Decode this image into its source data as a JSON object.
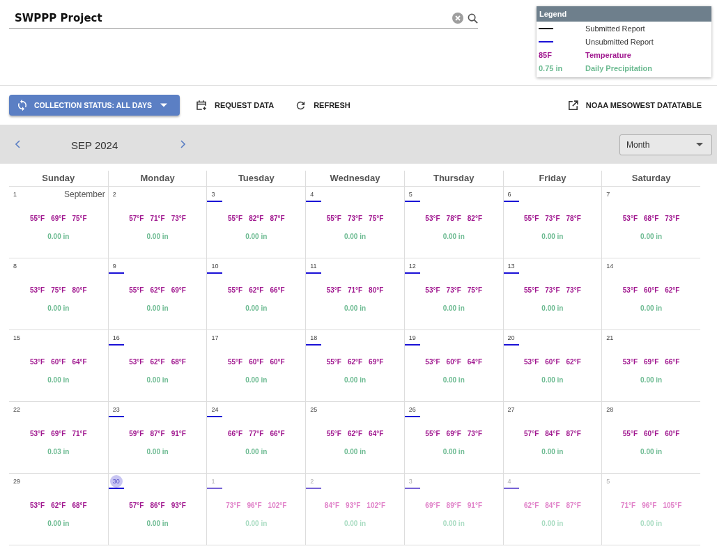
{
  "search": {
    "value": "SWPPP Project"
  },
  "legend": {
    "title": "Legend",
    "items": [
      {
        "kind": "submitted",
        "label": "Submitted Report"
      },
      {
        "kind": "unsubmitted",
        "label": "Unsubmitted Report"
      },
      {
        "kind": "temperature",
        "sample": "85F",
        "label": "Temperature"
      },
      {
        "kind": "precipitation",
        "sample": "0.75 in",
        "label": "Daily Precipitation"
      }
    ]
  },
  "toolbar": {
    "collection_status": "COLLECTION STATUS: ALL DAYS",
    "request": "REQUEST DATA",
    "refresh": "REFRESH",
    "noaa": "NOAA MESOWEST DATATABLE"
  },
  "nav": {
    "period": "SEP 2024",
    "view": "Month"
  },
  "weekdays": [
    "Sunday",
    "Monday",
    "Tuesday",
    "Wednesday",
    "Thursday",
    "Friday",
    "Saturday"
  ],
  "weeks": [
    [
      {
        "day": "1",
        "month_label": "September",
        "temps": [
          "55°F",
          "69°F",
          "75°F"
        ],
        "precip": "0.00 in",
        "unsubmitted": false,
        "outside_month": false,
        "today": false
      },
      {
        "day": "2",
        "temps": [
          "57°F",
          "71°F",
          "73°F"
        ],
        "precip": "0.00 in",
        "unsubmitted": false,
        "outside_month": false,
        "today": false
      },
      {
        "day": "3",
        "temps": [
          "55°F",
          "82°F",
          "87°F"
        ],
        "precip": "0.00 in",
        "unsubmitted": true,
        "outside_month": false,
        "today": false
      },
      {
        "day": "4",
        "temps": [
          "55°F",
          "73°F",
          "75°F"
        ],
        "precip": "0.00 in",
        "unsubmitted": true,
        "outside_month": false,
        "today": false
      },
      {
        "day": "5",
        "temps": [
          "53°F",
          "78°F",
          "82°F"
        ],
        "precip": "0.00 in",
        "unsubmitted": true,
        "outside_month": false,
        "today": false
      },
      {
        "day": "6",
        "temps": [
          "55°F",
          "73°F",
          "78°F"
        ],
        "precip": "0.00 in",
        "unsubmitted": true,
        "outside_month": false,
        "today": false
      },
      {
        "day": "7",
        "temps": [
          "53°F",
          "68°F",
          "73°F"
        ],
        "precip": "0.00 in",
        "unsubmitted": false,
        "outside_month": false,
        "today": false
      }
    ],
    [
      {
        "day": "8",
        "temps": [
          "53°F",
          "75°F",
          "80°F"
        ],
        "precip": "0.00 in",
        "unsubmitted": false,
        "outside_month": false,
        "today": false
      },
      {
        "day": "9",
        "temps": [
          "55°F",
          "62°F",
          "69°F"
        ],
        "precip": "0.00 in",
        "unsubmitted": true,
        "outside_month": false,
        "today": false
      },
      {
        "day": "10",
        "temps": [
          "55°F",
          "62°F",
          "66°F"
        ],
        "precip": "0.00 in",
        "unsubmitted": true,
        "outside_month": false,
        "today": false
      },
      {
        "day": "11",
        "temps": [
          "53°F",
          "71°F",
          "80°F"
        ],
        "precip": "0.00 in",
        "unsubmitted": true,
        "outside_month": false,
        "today": false
      },
      {
        "day": "12",
        "temps": [
          "53°F",
          "73°F",
          "75°F"
        ],
        "precip": "0.00 in",
        "unsubmitted": true,
        "outside_month": false,
        "today": false
      },
      {
        "day": "13",
        "temps": [
          "55°F",
          "73°F",
          "73°F"
        ],
        "precip": "0.00 in",
        "unsubmitted": true,
        "outside_month": false,
        "today": false
      },
      {
        "day": "14",
        "temps": [
          "53°F",
          "60°F",
          "62°F"
        ],
        "precip": "0.00 in",
        "unsubmitted": false,
        "outside_month": false,
        "today": false
      }
    ],
    [
      {
        "day": "15",
        "temps": [
          "53°F",
          "60°F",
          "64°F"
        ],
        "precip": "0.00 in",
        "unsubmitted": false,
        "outside_month": false,
        "today": false
      },
      {
        "day": "16",
        "temps": [
          "53°F",
          "62°F",
          "68°F"
        ],
        "precip": "0.00 in",
        "unsubmitted": true,
        "outside_month": false,
        "today": false
      },
      {
        "day": "17",
        "temps": [
          "55°F",
          "60°F",
          "60°F"
        ],
        "precip": "0.00 in",
        "unsubmitted": false,
        "outside_month": false,
        "today": false
      },
      {
        "day": "18",
        "temps": [
          "55°F",
          "62°F",
          "69°F"
        ],
        "precip": "0.00 in",
        "unsubmitted": true,
        "outside_month": false,
        "today": false
      },
      {
        "day": "19",
        "temps": [
          "53°F",
          "60°F",
          "64°F"
        ],
        "precip": "0.00 in",
        "unsubmitted": true,
        "outside_month": false,
        "today": false
      },
      {
        "day": "20",
        "temps": [
          "53°F",
          "60°F",
          "62°F"
        ],
        "precip": "0.00 in",
        "unsubmitted": true,
        "outside_month": false,
        "today": false
      },
      {
        "day": "21",
        "temps": [
          "53°F",
          "69°F",
          "66°F"
        ],
        "precip": "0.00 in",
        "unsubmitted": false,
        "outside_month": false,
        "today": false
      }
    ],
    [
      {
        "day": "22",
        "temps": [
          "53°F",
          "69°F",
          "71°F"
        ],
        "precip": "0.03 in",
        "unsubmitted": false,
        "outside_month": false,
        "today": false
      },
      {
        "day": "23",
        "temps": [
          "59°F",
          "87°F",
          "91°F"
        ],
        "precip": "0.00 in",
        "unsubmitted": true,
        "outside_month": false,
        "today": false
      },
      {
        "day": "24",
        "temps": [
          "66°F",
          "77°F",
          "66°F"
        ],
        "precip": "0.00 in",
        "unsubmitted": true,
        "outside_month": false,
        "today": false
      },
      {
        "day": "25",
        "temps": [
          "55°F",
          "62°F",
          "64°F"
        ],
        "precip": "0.00 in",
        "unsubmitted": false,
        "outside_month": false,
        "today": false
      },
      {
        "day": "26",
        "temps": [
          "55°F",
          "69°F",
          "73°F"
        ],
        "precip": "0.00 in",
        "unsubmitted": true,
        "outside_month": false,
        "today": false
      },
      {
        "day": "27",
        "temps": [
          "57°F",
          "84°F",
          "87°F"
        ],
        "precip": "0.00 in",
        "unsubmitted": false,
        "outside_month": false,
        "today": false
      },
      {
        "day": "28",
        "temps": [
          "55°F",
          "60°F",
          "60°F"
        ],
        "precip": "0.00 in",
        "unsubmitted": false,
        "outside_month": false,
        "today": false
      }
    ],
    [
      {
        "day": "29",
        "temps": [
          "53°F",
          "62°F",
          "68°F"
        ],
        "precip": "0.00 in",
        "unsubmitted": false,
        "outside_month": false,
        "today": false
      },
      {
        "day": "30",
        "temps": [
          "57°F",
          "86°F",
          "93°F"
        ],
        "precip": "0.00 in",
        "unsubmitted": true,
        "outside_month": false,
        "today": true
      },
      {
        "day": "1",
        "temps": [
          "73°F",
          "96°F",
          "102°F"
        ],
        "precip": "0.00 in",
        "unsubmitted": true,
        "outside_month": true,
        "today": false
      },
      {
        "day": "2",
        "temps": [
          "84°F",
          "93°F",
          "102°F"
        ],
        "precip": "0.00 in",
        "unsubmitted": true,
        "outside_month": true,
        "today": false
      },
      {
        "day": "3",
        "temps": [
          "69°F",
          "89°F",
          "91°F"
        ],
        "precip": "0.00 in",
        "unsubmitted": true,
        "outside_month": true,
        "today": false
      },
      {
        "day": "4",
        "temps": [
          "62°F",
          "84°F",
          "87°F"
        ],
        "precip": "0.00 in",
        "unsubmitted": true,
        "outside_month": true,
        "today": false
      },
      {
        "day": "5",
        "temps": [
          "71°F",
          "96°F",
          "105°F"
        ],
        "precip": "0.00 in",
        "unsubmitted": false,
        "outside_month": true,
        "today": false
      }
    ]
  ]
}
